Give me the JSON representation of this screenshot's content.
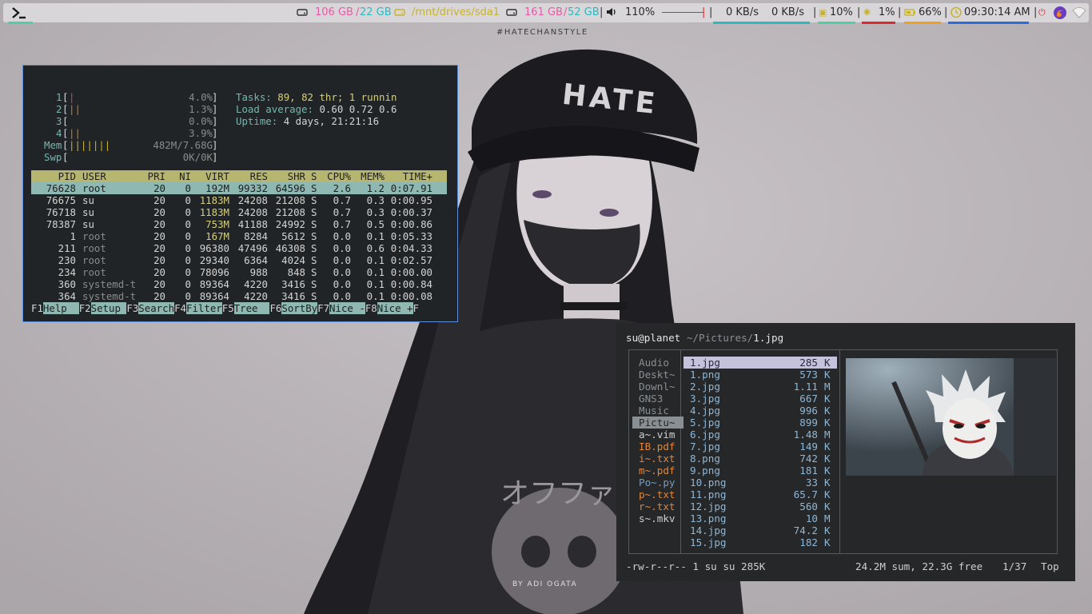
{
  "topbar": {
    "disk1_used": "106 GB",
    "disk1_sep": "/",
    "disk1_free": "22 GB",
    "mount_path": "/mnt/drives/sda1",
    "disk2_used": "161 GB",
    "disk2_sep": "/",
    "disk2_free": "52 GB",
    "volume": "110%",
    "net_down": "0 KB/s",
    "net_up": "0 KB/s",
    "cpu": "10%",
    "ram": "1%",
    "battery": "66%",
    "clock": "09:30:14 AM",
    "colors": {
      "pink": "#e85aa6",
      "cyan": "#2eb8c0",
      "yellow": "#c7b22c",
      "green": "#4dd0a6",
      "red": "#e0282d",
      "orange": "#f0a020",
      "blue": "#2a6be0"
    }
  },
  "wallpaper": {
    "watermark": "#HATECHANSTYLE",
    "cap_text": "HATE",
    "shirt_text": "オフファ",
    "credit": "BY ADI OGATA"
  },
  "htop": {
    "cpu_lines": [
      {
        "num": "1",
        "bars": "|",
        "pct": "4.0%"
      },
      {
        "num": "2",
        "bars": "||",
        "pct": "1.3%"
      },
      {
        "num": "3",
        "bars": "",
        "pct": "0.0%"
      },
      {
        "num": "4",
        "bars": "||",
        "pct": "3.9%"
      }
    ],
    "mem_label": "Mem",
    "mem_bars": "|||||||",
    "mem_value": "482M/7.68G",
    "swp_label": "Swp",
    "swp_value": "0K/0K",
    "tasks_label": "Tasks:",
    "tasks_value": "89, 82 thr; 1 runnin",
    "load_label": "Load average:",
    "load_value": "0.60 0.72 0.6",
    "uptime_label": "Uptime:",
    "uptime_value": "4 days, 21:21:16",
    "columns": [
      "PID",
      "USER",
      "PRI",
      "NI",
      "VIRT",
      "RES",
      "SHR",
      "S",
      "CPU%",
      "MEM%",
      "TIME+"
    ],
    "processes": [
      [
        "76628",
        "root",
        "20",
        "0",
        "192M",
        "99332",
        "64596",
        "S",
        "2.6",
        "1.2",
        "0:07.91"
      ],
      [
        "76675",
        "su",
        "20",
        "0",
        "1183M",
        "24208",
        "21208",
        "S",
        "0.7",
        "0.3",
        "0:00.95"
      ],
      [
        "76718",
        "su",
        "20",
        "0",
        "1183M",
        "24208",
        "21208",
        "S",
        "0.7",
        "0.3",
        "0:00.37"
      ],
      [
        "78387",
        "su",
        "20",
        "0",
        "753M",
        "41188",
        "24992",
        "S",
        "0.7",
        "0.5",
        "0:00.86"
      ],
      [
        "1",
        "root",
        "20",
        "0",
        "167M",
        "8284",
        "5612",
        "S",
        "0.0",
        "0.1",
        "0:05.33"
      ],
      [
        "211",
        "root",
        "20",
        "0",
        "96380",
        "47496",
        "46308",
        "S",
        "0.0",
        "0.6",
        "0:04.33"
      ],
      [
        "230",
        "root",
        "20",
        "0",
        "29340",
        "6364",
        "4024",
        "S",
        "0.0",
        "0.1",
        "0:02.57"
      ],
      [
        "234",
        "root",
        "20",
        "0",
        "78096",
        "988",
        "848",
        "S",
        "0.0",
        "0.1",
        "0:00.00"
      ],
      [
        "360",
        "systemd-t",
        "20",
        "0",
        "89364",
        "4220",
        "3416",
        "S",
        "0.0",
        "0.1",
        "0:00.84"
      ],
      [
        "364",
        "systemd-t",
        "20",
        "0",
        "89364",
        "4220",
        "3416",
        "S",
        "0.0",
        "0.1",
        "0:00.08"
      ]
    ],
    "fkeys": [
      {
        "key": "F1",
        "label": "Help  "
      },
      {
        "key": "F2",
        "label": "Setup "
      },
      {
        "key": "F3",
        "label": "Search"
      },
      {
        "key": "F4",
        "label": "Filter"
      },
      {
        "key": "F5",
        "label": "Tree  "
      },
      {
        "key": "F6",
        "label": "SortBy"
      },
      {
        "key": "F7",
        "label": "Nice -"
      },
      {
        "key": "F8",
        "label": "Nice +"
      },
      {
        "key": "F",
        "label": ""
      }
    ]
  },
  "ranger": {
    "user_host": "su@planet",
    "path_dir": "~/Pictures/",
    "path_file": "1.jpg",
    "parent_items": [
      {
        "name": "Audio",
        "kind": "dir"
      },
      {
        "name": "Deskt~",
        "kind": "dir"
      },
      {
        "name": "Downl~",
        "kind": "dir"
      },
      {
        "name": "GNS3",
        "kind": "dir"
      },
      {
        "name": "Music",
        "kind": "dir"
      },
      {
        "name": "Pictu~",
        "kind": "selected"
      },
      {
        "name": "a~.vim",
        "kind": "file"
      },
      {
        "name": "IB.pdf",
        "kind": "pdf"
      },
      {
        "name": "i~.txt",
        "kind": "pdf"
      },
      {
        "name": "m~.pdf",
        "kind": "pdf"
      },
      {
        "name": "Po~.py",
        "kind": "py"
      },
      {
        "name": "p~.txt",
        "kind": "pdf"
      },
      {
        "name": "r~.txt",
        "kind": "pdf"
      },
      {
        "name": "s~.mkv",
        "kind": "file"
      }
    ],
    "files": [
      {
        "name": "1.jpg",
        "size": "285",
        "unit": "K"
      },
      {
        "name": "1.png",
        "size": "573",
        "unit": "K"
      },
      {
        "name": "2.jpg",
        "size": "1.11",
        "unit": "M"
      },
      {
        "name": "3.jpg",
        "size": "667",
        "unit": "K"
      },
      {
        "name": "4.jpg",
        "size": "996",
        "unit": "K"
      },
      {
        "name": "5.jpg",
        "size": "899",
        "unit": "K"
      },
      {
        "name": "6.jpg",
        "size": "1.48",
        "unit": "M"
      },
      {
        "name": "7.jpg",
        "size": "149",
        "unit": "K"
      },
      {
        "name": "8.png",
        "size": "742",
        "unit": "K"
      },
      {
        "name": "9.png",
        "size": "181",
        "unit": "K"
      },
      {
        "name": "10.png",
        "size": "33",
        "unit": "K"
      },
      {
        "name": "11.png",
        "size": "65.7",
        "unit": "K"
      },
      {
        "name": "12.jpg",
        "size": "560",
        "unit": "K"
      },
      {
        "name": "13.png",
        "size": "10",
        "unit": "M"
      },
      {
        "name": "14.jpg",
        "size": "74.2",
        "unit": "K"
      },
      {
        "name": "15.jpg",
        "size": "182",
        "unit": "K"
      }
    ],
    "status_perms": "-rw-r--r-- 1 su su 285K",
    "status_summary": "24.2M sum, 22.3G free",
    "status_pos": "1/37",
    "status_scroll": "Top"
  }
}
